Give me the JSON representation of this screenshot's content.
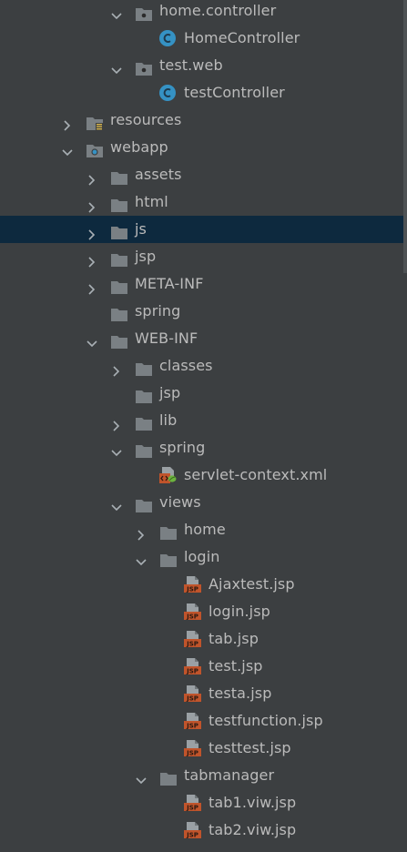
{
  "tree": {
    "rows": [
      {
        "label": "home.controller",
        "type": "package",
        "expanded": true,
        "selected": false
      },
      {
        "label": "HomeController",
        "type": "class",
        "selected": false
      },
      {
        "label": "test.web",
        "type": "package",
        "expanded": true,
        "selected": false
      },
      {
        "label": "testController",
        "type": "class",
        "selected": false
      },
      {
        "label": "resources",
        "type": "resources-folder",
        "expanded": false,
        "selected": false
      },
      {
        "label": "webapp",
        "type": "webapp-folder",
        "expanded": true,
        "selected": false
      },
      {
        "label": "assets",
        "type": "folder",
        "expanded": false,
        "selected": false
      },
      {
        "label": "html",
        "type": "folder",
        "expanded": false,
        "selected": false
      },
      {
        "label": "js",
        "type": "folder",
        "expanded": false,
        "selected": true
      },
      {
        "label": "jsp",
        "type": "folder",
        "expanded": false,
        "selected": false
      },
      {
        "label": "META-INF",
        "type": "folder",
        "expanded": false,
        "selected": false
      },
      {
        "label": "spring",
        "type": "folder",
        "selected": false
      },
      {
        "label": "WEB-INF",
        "type": "folder",
        "expanded": true,
        "selected": false
      },
      {
        "label": "classes",
        "type": "folder",
        "expanded": false,
        "selected": false
      },
      {
        "label": "jsp",
        "type": "folder",
        "selected": false
      },
      {
        "label": "lib",
        "type": "folder",
        "expanded": false,
        "selected": false
      },
      {
        "label": "spring",
        "type": "folder",
        "expanded": true,
        "selected": false
      },
      {
        "label": "servlet-context.xml",
        "type": "spring-xml",
        "selected": false
      },
      {
        "label": "views",
        "type": "folder",
        "expanded": true,
        "selected": false
      },
      {
        "label": "home",
        "type": "folder",
        "expanded": false,
        "selected": false
      },
      {
        "label": "login",
        "type": "folder",
        "expanded": true,
        "selected": false
      },
      {
        "label": "Ajaxtest.jsp",
        "type": "jsp",
        "selected": false
      },
      {
        "label": "login.jsp",
        "type": "jsp",
        "selected": false
      },
      {
        "label": "tab.jsp",
        "type": "jsp",
        "selected": false
      },
      {
        "label": "test.jsp",
        "type": "jsp",
        "selected": false
      },
      {
        "label": "testa.jsp",
        "type": "jsp",
        "selected": false
      },
      {
        "label": "testfunction.jsp",
        "type": "jsp",
        "selected": false
      },
      {
        "label": "testtest.jsp",
        "type": "jsp",
        "selected": false
      },
      {
        "label": "tabmanager",
        "type": "folder",
        "expanded": true,
        "selected": false
      },
      {
        "label": "tab1.viw.jsp",
        "type": "jsp",
        "selected": false
      },
      {
        "label": "tab2.viw.jsp",
        "type": "jsp",
        "selected": false
      }
    ]
  },
  "colors": {
    "background": "#3c3f41",
    "selection": "#0d293e",
    "text": "#bbbbbb",
    "folder": "#7a8084",
    "class_badge": "#3592c4",
    "jsp_badge": "#c0542b"
  }
}
